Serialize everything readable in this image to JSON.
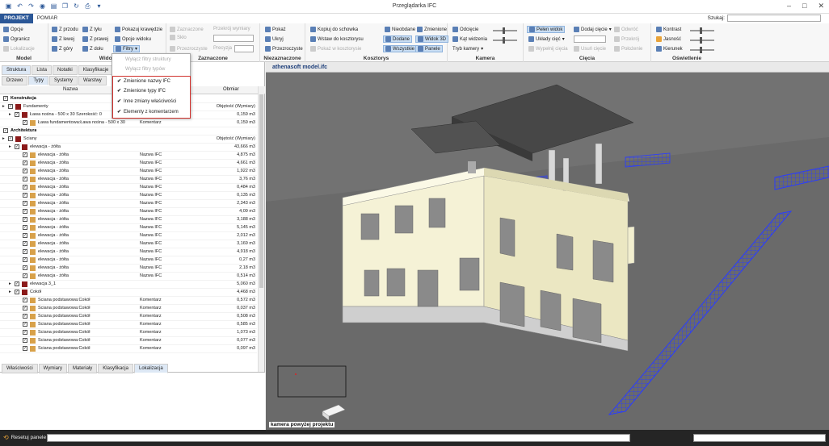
{
  "title": "Przeglądarka IFC",
  "ribbon_tabs": [
    "PROJEKT",
    "POMIAR"
  ],
  "search_label": "Szukaj:",
  "groups": {
    "model": {
      "label": "Model",
      "items": [
        "Opcje",
        "Ogranicz",
        "Lokalizacje"
      ]
    },
    "widok": {
      "label": "Widok",
      "items": [
        "Z przodu",
        "Z lewej",
        "Z góry",
        "Z tyłu",
        "Z prawej",
        "Z dołu",
        "Pokazuj krawędzie",
        "Opcje widoku",
        "Filtry"
      ]
    },
    "zaznaczone": {
      "label": "Zaznaczone",
      "items": [
        "Zaznaczone",
        "Skło",
        "Przezroczyste",
        "Przekrój wymiary",
        "Precyzja"
      ]
    },
    "niezaznaczone": {
      "label": "Niezaznaczone",
      "items": [
        "Pokaż",
        "Ukryj",
        "Przezroczyste"
      ]
    },
    "kosztorys": {
      "label": "Kosztorys",
      "items": [
        "Kopiuj do schowka",
        "Wstaw do kosztorysu",
        "Pokaż w kosztorysie",
        "Nieobdane",
        "Dodane",
        "Wszystkie",
        "Zmienione",
        "Widok 3D",
        "Panele"
      ]
    },
    "kamera": {
      "label": "Kamera",
      "items": [
        "Odcięcie",
        "Kąt widzenia",
        "Tryb kamery"
      ]
    },
    "ciecia": {
      "label": "Cięcia",
      "items": [
        "Pełen widok",
        "Układy cięć",
        "Wypełnij cięcia",
        "Dodaj cięcie",
        "Usuń cięcie",
        "Odwróć",
        "Przekrój",
        "Położenie"
      ]
    },
    "oswietlenie": {
      "label": "Oświetlenie",
      "items": [
        "Kontrast",
        "Jasność",
        "Kierunek"
      ]
    }
  },
  "filter_menu": {
    "disabled": [
      "Wyłącz filtry struktury",
      "Wyłącz filtry typów"
    ],
    "checked": [
      "Zmienione nazwy IFC",
      "Zmienione typy IFC",
      "Inne zmiany właściwości",
      "Elementy z komentarzem"
    ]
  },
  "left_tabs_top": [
    "Struktura",
    "Lista",
    "Notatki",
    "Klasyfikacje"
  ],
  "left_tabs_second": [
    "Drzewo",
    "Typy",
    "Systemy",
    "Warstwy"
  ],
  "table_headers": [
    "Nazwa",
    "Obmiar"
  ],
  "tree_rows": [
    {
      "name": "Konstrukcja",
      "comment": "",
      "value": "",
      "level": 0,
      "bold": true,
      "color": "#8b1a1a"
    },
    {
      "name": "Fundamenty",
      "comment": "",
      "value": "Objętość (Wymiary)",
      "level": 1,
      "bold": false,
      "color": "#8b1a1a"
    },
    {
      "name": "Ława nośna - 500 x 30 Szerokość: 0",
      "comment": "",
      "value": "0,159 m3",
      "level": 2,
      "bold": false,
      "color": "#8b1a1a"
    },
    {
      "name": "Ława fundamentowa:Ława nośna - 500 x 30",
      "comment": "Komentarz",
      "value": "0,159 m3",
      "level": 3,
      "bold": false,
      "color": "#d8a14a"
    },
    {
      "name": "Architektura",
      "comment": "",
      "value": "",
      "level": 0,
      "bold": true,
      "color": "#8b1a1a"
    },
    {
      "name": "Ściany",
      "comment": "",
      "value": "Objętość (Wymiary)",
      "level": 1,
      "bold": false,
      "color": "#8b1a1a"
    },
    {
      "name": "elewacja - żółta",
      "comment": "",
      "value": "43,666 m3",
      "level": 2,
      "bold": false,
      "color": "#8b1a1a"
    },
    {
      "name": "elewacja - żółta",
      "comment": "Nazwa IFC",
      "value": "4,875 m3",
      "level": 3,
      "bold": false,
      "color": "#d8a14a"
    },
    {
      "name": "elewacja - żółta",
      "comment": "Nazwa IFC",
      "value": "4,661 m3",
      "level": 3,
      "bold": false,
      "color": "#d8a14a"
    },
    {
      "name": "elewacja - żółta",
      "comment": "Nazwa IFC",
      "value": "1,922 m3",
      "level": 3,
      "bold": false,
      "color": "#d8a14a"
    },
    {
      "name": "elewacja - żółta",
      "comment": "Nazwa IFC",
      "value": "3,76 m3",
      "level": 3,
      "bold": false,
      "color": "#d8a14a"
    },
    {
      "name": "elewacja - żółta",
      "comment": "Nazwa IFC",
      "value": "0,484 m3",
      "level": 3,
      "bold": false,
      "color": "#d8a14a"
    },
    {
      "name": "elewacja - żółta",
      "comment": "Nazwa IFC",
      "value": "0,135 m3",
      "level": 3,
      "bold": false,
      "color": "#d8a14a"
    },
    {
      "name": "elewacja - żółta",
      "comment": "Nazwa IFC",
      "value": "2,343 m3",
      "level": 3,
      "bold": false,
      "color": "#d8a14a"
    },
    {
      "name": "elewacja - żółta",
      "comment": "Nazwa IFC",
      "value": "4,09 m3",
      "level": 3,
      "bold": false,
      "color": "#d8a14a"
    },
    {
      "name": "elewacja - żółta",
      "comment": "Nazwa IFC",
      "value": "3,188 m3",
      "level": 3,
      "bold": false,
      "color": "#d8a14a"
    },
    {
      "name": "elewacja - żółta",
      "comment": "Nazwa IFC",
      "value": "5,145 m3",
      "level": 3,
      "bold": false,
      "color": "#d8a14a"
    },
    {
      "name": "elewacja - żółta",
      "comment": "Nazwa IFC",
      "value": "2,012 m3",
      "level": 3,
      "bold": false,
      "color": "#d8a14a"
    },
    {
      "name": "elewacja - żółta",
      "comment": "Nazwa IFC",
      "value": "3,169 m3",
      "level": 3,
      "bold": false,
      "color": "#d8a14a"
    },
    {
      "name": "elewacja - żółta",
      "comment": "Nazwa IFC",
      "value": "4,918 m3",
      "level": 3,
      "bold": false,
      "color": "#d8a14a"
    },
    {
      "name": "elewacja - żółta",
      "comment": "Nazwa IFC",
      "value": "0,27 m3",
      "level": 3,
      "bold": false,
      "color": "#d8a14a"
    },
    {
      "name": "elewacja - żółta",
      "comment": "Nazwa IFC",
      "value": "2,18 m3",
      "level": 3,
      "bold": false,
      "color": "#d8a14a"
    },
    {
      "name": "elewacja - żółta",
      "comment": "Nazwa IFC",
      "value": "0,514 m3",
      "level": 3,
      "bold": false,
      "color": "#d8a14a"
    },
    {
      "name": "elewacja 3_1",
      "comment": "",
      "value": "5,060 m3",
      "level": 2,
      "bold": false,
      "color": "#8b1a1a"
    },
    {
      "name": "Cokół",
      "comment": "",
      "value": "4,468 m3",
      "level": 2,
      "bold": false,
      "color": "#8b1a1a"
    },
    {
      "name": "Ściana podstawowa:Cokół",
      "comment": "Komentarz",
      "value": "0,572 m3",
      "level": 3,
      "bold": false,
      "color": "#d8a14a"
    },
    {
      "name": "Ściana podstawowa:Cokół",
      "comment": "Komentarz",
      "value": "0,037 m3",
      "level": 3,
      "bold": false,
      "color": "#d8a14a"
    },
    {
      "name": "Ściana podstawowa:Cokół",
      "comment": "Komentarz",
      "value": "0,508 m3",
      "level": 3,
      "bold": false,
      "color": "#d8a14a"
    },
    {
      "name": "Ściana podstawowa:Cokół",
      "comment": "Komentarz",
      "value": "0,585 m3",
      "level": 3,
      "bold": false,
      "color": "#d8a14a"
    },
    {
      "name": "Ściana podstawowa:Cokół",
      "comment": "Komentarz",
      "value": "1,073 m3",
      "level": 3,
      "bold": false,
      "color": "#d8a14a"
    },
    {
      "name": "Ściana podstawowa:Cokół",
      "comment": "Komentarz",
      "value": "0,077 m3",
      "level": 3,
      "bold": false,
      "color": "#d8a14a"
    },
    {
      "name": "Ściana podstawowa:Cokół",
      "comment": "Komentarz",
      "value": "0,097 m3",
      "level": 3,
      "bold": false,
      "color": "#d8a14a"
    }
  ],
  "bottom_tabs": [
    "Właściwości",
    "Wymiary",
    "Materiały",
    "Klasyfikacja",
    "Lokalizacja"
  ],
  "viewport_title": "athenasoft model.ifc",
  "viewport_caption": "kamera powyżej projektu",
  "status_button": "Resetuj panele",
  "colors": {
    "accent": "#2b5797",
    "highlight_border": "#d0312d",
    "fence": "#2a3cff",
    "walls": "#f2efcf",
    "roof": "#474747"
  }
}
